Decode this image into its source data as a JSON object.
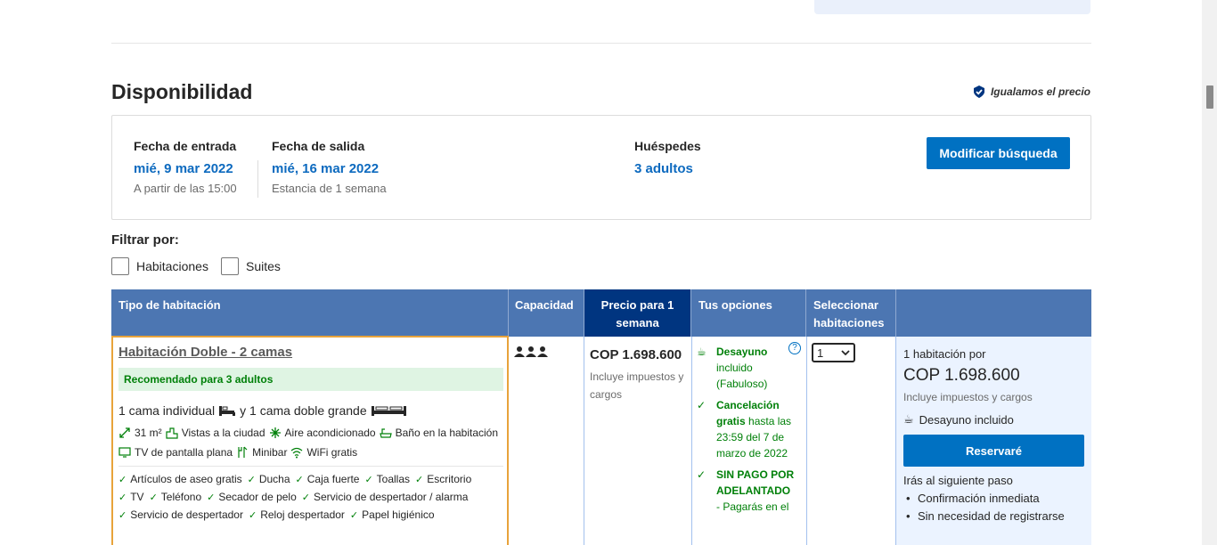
{
  "section": {
    "title": "Disponibilidad",
    "price_match": "Igualamos el precio"
  },
  "search": {
    "checkin_label": "Fecha de entrada",
    "checkin_value": "mié, 9 mar 2022",
    "checkin_sub": "A partir de las 15:00",
    "checkout_label": "Fecha de salida",
    "checkout_value": "mié, 16 mar 2022",
    "checkout_sub": "Estancia de 1 semana",
    "guests_label": "Huéspedes",
    "guests_value": "3 adultos",
    "modify_button": "Modificar búsqueda"
  },
  "filters": {
    "title": "Filtrar por:",
    "options": [
      "Habitaciones",
      "Suites"
    ]
  },
  "table": {
    "headers": {
      "room_type": "Tipo de habitación",
      "capacity": "Capacidad",
      "price": "Precio para 1 semana",
      "options": "Tus opciones",
      "select": "Seleccionar habitaciones"
    }
  },
  "room": {
    "name": "Habitación Doble - 2 camas",
    "recommended": "Recomendado para 3 adultos",
    "beds_part1": "1 cama individual",
    "beds_join": "y 1 cama doble grande",
    "amenities_row1": [
      "31 m²",
      "Vistas a la ciudad",
      "Aire acondicionado",
      "Baño en la habitación"
    ],
    "amenities_row2": [
      "TV de pantalla plana",
      "Minibar",
      "WiFi gratis"
    ],
    "features_row1": [
      "Artículos de aseo gratis",
      "Ducha",
      "Caja fuerte",
      "Toallas",
      "Escritorio"
    ],
    "features_row2": [
      "TV",
      "Teléfono",
      "Secador de pelo",
      "Servicio de despertador / alarma"
    ],
    "features_row3": [
      "Servicio de despertador",
      "Reloj despertador",
      "Papel higiénico"
    ],
    "price": "COP 1.698.600",
    "price_note": "Incluye impuestos y cargos",
    "options": {
      "breakfast_title": "Desayuno",
      "breakfast_rest": "incluido (Fabuloso)",
      "cancel_title": "Cancelación gratis",
      "cancel_rest": "hasta las 23:59 del 7 de marzo de 2022",
      "nopay_title": "SIN PAGO POR ADELANTADO",
      "nopay_rest": "- Pagarás en el"
    },
    "selected_qty": "1"
  },
  "reservation": {
    "line1": "1 habitación por",
    "price": "COP 1.698.600",
    "note": "Incluye impuestos y cargos",
    "breakfast": "Desayuno incluido",
    "button": "Reservaré",
    "next_step": "Irás al siguiente paso",
    "benefits": [
      "Confirmación inmediata",
      "Sin necesidad de registrarse"
    ]
  },
  "colors": {
    "header_blue": "#4c76b2",
    "dark_blue": "#003580",
    "primary_button": "#0071c2",
    "link_blue": "#0d6abf",
    "green": "#008009",
    "highlight_orange": "#e8a33b"
  }
}
